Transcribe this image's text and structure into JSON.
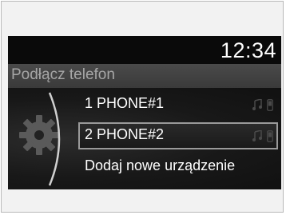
{
  "status": {
    "time": "12:34"
  },
  "header": {
    "title": "Podłącz telefon"
  },
  "menu": {
    "items": [
      {
        "label": "1 PHONE#1",
        "icons": [
          "music-icon",
          "phone-icon"
        ]
      },
      {
        "label": "2 PHONE#2",
        "icons": [
          "music-icon",
          "phone-icon"
        ],
        "selected": true
      },
      {
        "label": "Dodaj nowe urządzenie"
      }
    ]
  },
  "colors": {
    "background": "#111111",
    "text": "#ffffff",
    "title": "#a6a6a6",
    "highlight": "#9a9a9a"
  }
}
